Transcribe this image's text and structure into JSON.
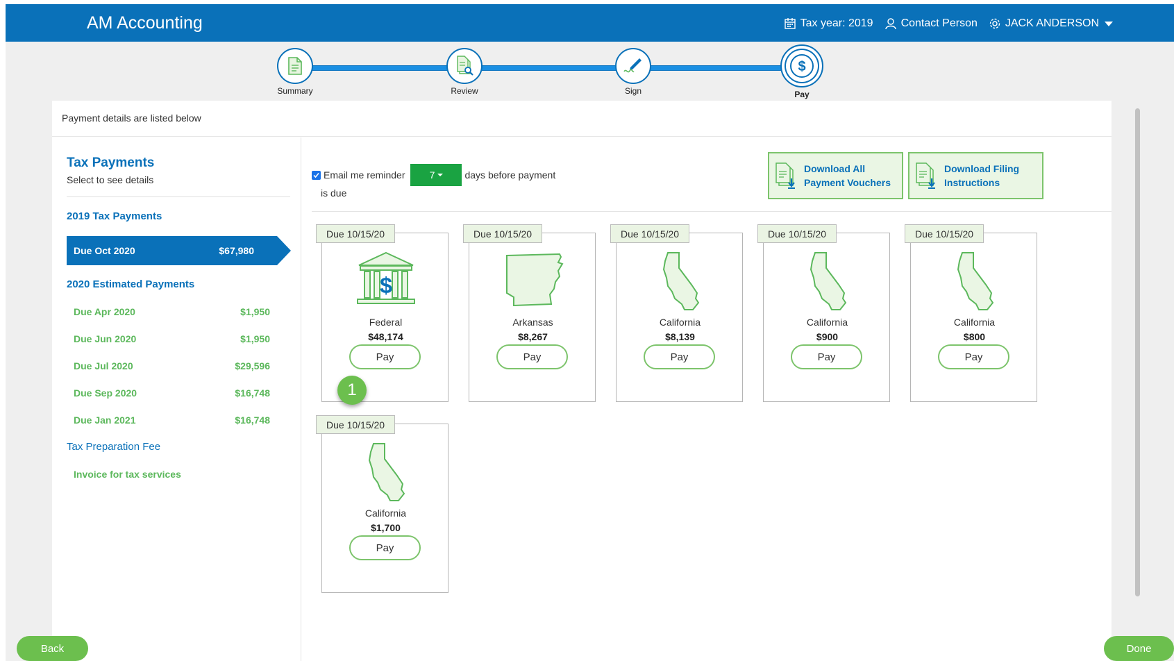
{
  "header": {
    "brand": "AM Accounting",
    "tax_year": "Tax year: 2019",
    "contact": "Contact Person",
    "user": "JACK ANDERSON"
  },
  "stepper": {
    "steps": [
      {
        "label": "Summary",
        "icon": "summary-document-icon"
      },
      {
        "label": "Review",
        "icon": "review-document-icon"
      },
      {
        "label": "Sign",
        "icon": "pen-signature-icon"
      },
      {
        "label": "Pay",
        "icon": "dollar-icon"
      }
    ],
    "active": "Pay"
  },
  "panel": {
    "header_text": "Payment details are listed below"
  },
  "sidebar": {
    "title": "Tax Payments",
    "subtitle": "Select to see details",
    "group1": "2019 Tax Payments",
    "active_item": {
      "label": "Due Oct 2020",
      "amount": "$67,980"
    },
    "group2": "2020 Estimated Payments",
    "estimated": [
      {
        "label": "Due Apr 2020",
        "amount": "$1,950"
      },
      {
        "label": "Due Jun 2020",
        "amount": "$1,950"
      },
      {
        "label": "Due Jul 2020",
        "amount": "$29,596"
      },
      {
        "label": "Due Sep 2020",
        "amount": "$16,748"
      },
      {
        "label": "Due Jan 2021",
        "amount": "$16,748"
      }
    ],
    "fee_group": "Tax Preparation Fee",
    "invoice": "Invoice for tax services"
  },
  "reminder": {
    "prefix": "Email me reminder",
    "days": "7",
    "suffix": "days before payment",
    "suffix2": "is due",
    "checked": true
  },
  "downloads": {
    "vouchers_line1": "Download All",
    "vouchers_line2": "Payment Vouchers",
    "instructions_line1": "Download Filing",
    "instructions_line2": "Instructions"
  },
  "cards": [
    {
      "due": "Due 10/15/20",
      "name": "Federal",
      "amount": "$48,174",
      "pay": "Pay",
      "icon": "federal-bank-icon"
    },
    {
      "due": "Due 10/15/20",
      "name": "Arkansas",
      "amount": "$8,267",
      "pay": "Pay",
      "icon": "arkansas-map-icon"
    },
    {
      "due": "Due 10/15/20",
      "name": "California",
      "amount": "$8,139",
      "pay": "Pay",
      "icon": "california-map-icon"
    },
    {
      "due": "Due 10/15/20",
      "name": "California",
      "amount": "$900",
      "pay": "Pay",
      "icon": "california-map-icon"
    },
    {
      "due": "Due 10/15/20",
      "name": "California",
      "amount": "$800",
      "pay": "Pay",
      "icon": "california-map-icon"
    },
    {
      "due": "Due 10/15/20",
      "name": "California",
      "amount": "$1,700",
      "pay": "Pay",
      "icon": "california-map-icon"
    }
  ],
  "marker": "1",
  "footer": {
    "back": "Back",
    "done": "Done"
  },
  "colors": {
    "brand_blue": "#0a71b9",
    "accent_green": "#6cbf4e",
    "days_green": "#1aa342"
  }
}
